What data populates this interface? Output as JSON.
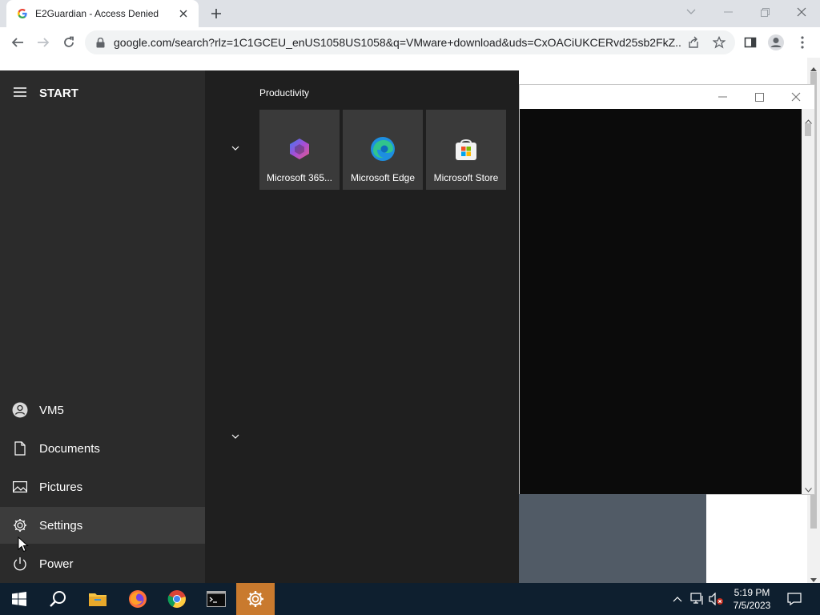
{
  "browser": {
    "tab_title": "E2Guardian - Access Denied",
    "url": "google.com/search?rlz=1C1GCEU_enUS1058US1058&q=VMware+download&uds=CxOACiUKCERvd25sb2FkZ..."
  },
  "start_menu": {
    "title": "START",
    "user": "VM5",
    "nav": {
      "documents": "Documents",
      "pictures": "Pictures",
      "settings": "Settings",
      "power": "Power"
    },
    "group_label": "Productivity",
    "tiles": [
      {
        "label": "Microsoft 365...",
        "icon": "microsoft-365-icon"
      },
      {
        "label": "Microsoft Edge",
        "icon": "edge-icon"
      },
      {
        "label": "Microsoft Store",
        "icon": "store-icon"
      }
    ]
  },
  "taskbar": {
    "time": "5:19 PM",
    "date": "7/5/2023",
    "apps": [
      "start-icon",
      "search-icon",
      "file-explorer-icon",
      "firefox-icon",
      "chrome-icon",
      "terminal-icon",
      "settings-icon"
    ]
  },
  "colors": {
    "taskbar": "#0e1f2f",
    "start_left": "#2b2b2b",
    "start_right": "#1f1f1f",
    "active_app": "#c97a2e"
  }
}
